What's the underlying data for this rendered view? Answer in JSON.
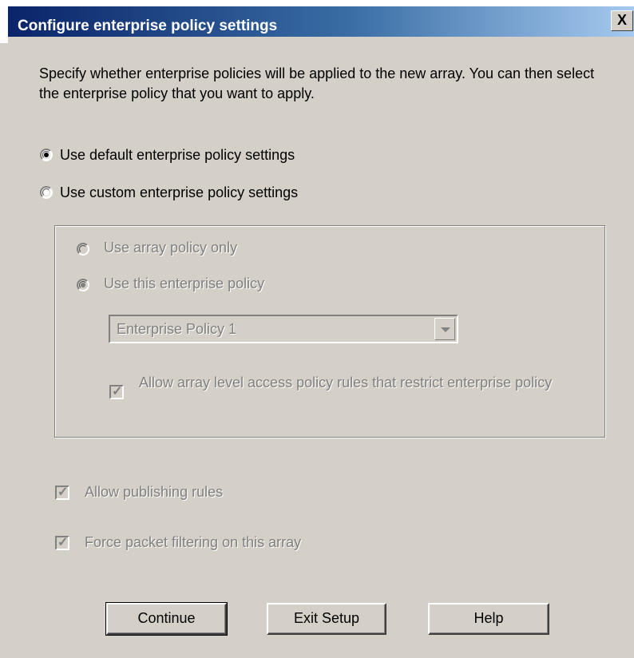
{
  "window": {
    "title": "Configure enterprise policy settings",
    "close_glyph": "X"
  },
  "description": "Specify whether enterprise policies will be applied to the new array. You can then select the enterprise policy that you want to apply.",
  "policy_mode": {
    "options": [
      {
        "label": "Use default enterprise policy settings",
        "selected": true
      },
      {
        "label": "Use custom enterprise policy settings",
        "selected": false
      }
    ]
  },
  "custom_group": {
    "options": [
      {
        "label": "Use array policy only",
        "selected": false,
        "enabled": false
      },
      {
        "label": "Use this enterprise policy",
        "selected": true,
        "enabled": false
      }
    ],
    "policy_select": {
      "value": "Enterprise Policy 1",
      "enabled": false
    },
    "allow_restrict": {
      "label": "Allow array level access policy rules that restrict enterprise policy",
      "checked": true,
      "enabled": false
    }
  },
  "checkboxes": [
    {
      "label": "Allow publishing rules",
      "checked": true,
      "enabled": false
    },
    {
      "label": "Force packet filtering on this array",
      "checked": true,
      "enabled": false
    }
  ],
  "buttons": {
    "continue": "Continue",
    "exit_setup": "Exit Setup",
    "help": "Help"
  },
  "colors": {
    "title_start": "#0a246a",
    "title_end": "#a6caf0",
    "face": "#d4d0c8",
    "disabled_text": "#808080"
  }
}
